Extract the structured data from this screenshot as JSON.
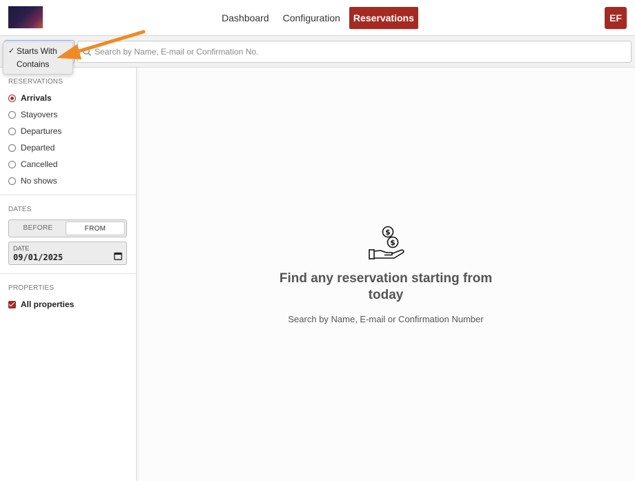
{
  "nav": {
    "items": [
      {
        "label": "Dashboard"
      },
      {
        "label": "Configuration"
      },
      {
        "label": "Reservations"
      }
    ]
  },
  "user": {
    "initials": "EF"
  },
  "search": {
    "placeholder": "Search by Name, E-mail or Confirmation No.",
    "mode_options": [
      {
        "label": "Starts With",
        "selected": true
      },
      {
        "label": "Contains",
        "selected": false
      }
    ],
    "check_mark": "✓"
  },
  "sidebar": {
    "reservations_title": "RESERVATIONS",
    "reservation_types": [
      {
        "label": "Arrivals",
        "checked": true
      },
      {
        "label": "Stayovers",
        "checked": false
      },
      {
        "label": "Departures",
        "checked": false
      },
      {
        "label": "Departed",
        "checked": false
      },
      {
        "label": "Cancelled",
        "checked": false
      },
      {
        "label": "No shows",
        "checked": false
      }
    ],
    "dates_title": "DATES",
    "date_mode": {
      "before": "BEFORE",
      "from": "FROM",
      "selected": "from"
    },
    "date_label": "DATE",
    "date_value": "09/01/2025",
    "properties_title": "PROPERTIES",
    "all_properties": {
      "label": "All properties",
      "checked": true
    }
  },
  "empty_state": {
    "title": "Find any reservation starting from today",
    "subtitle": "Search by Name, E-mail or Confirmation Number"
  },
  "colors": {
    "accent": "#a62a22",
    "annotation_arrow": "#f08a24"
  }
}
